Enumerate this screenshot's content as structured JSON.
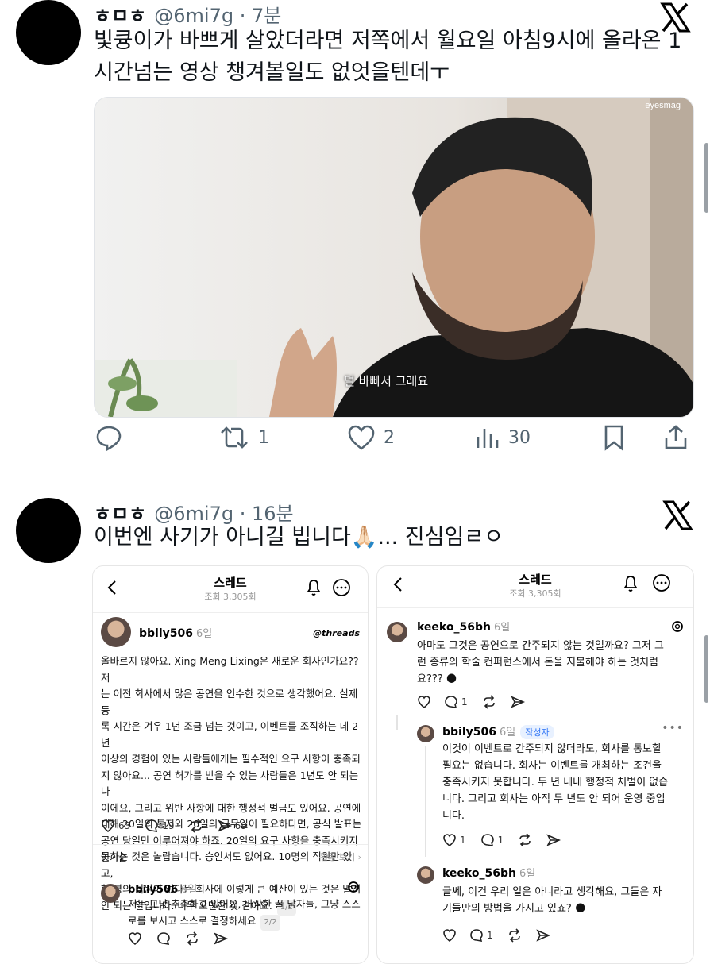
{
  "tweet1": {
    "name": "ㅎㅁㅎ",
    "handle": "@6mi7g",
    "time": "· 7분",
    "text": "빛큥이가 바쁘게 살았더라면 저쪽에서 월요일 아침9시에 올라온 1시간넘는 영상 챙겨볼일도 없엇을텐데ㅜ",
    "media": {
      "watermark": "eyesmag",
      "subtitle": "덜 바빠서 그래요"
    },
    "actions": {
      "retweets": "1",
      "likes": "2",
      "views": "30"
    }
  },
  "tweet2": {
    "name": "ㅎㅁㅎ",
    "handle": "@6mi7g",
    "time": "· 16분",
    "text": "이번엔 사기가 아니길 빕니다🙏🏻... 진심임ㄹㅇ"
  },
  "threads_left": {
    "title": "스레드",
    "views": "조회 3,305회",
    "post": {
      "user": "bbily506",
      "ago": "6일",
      "brand": "threads",
      "lines": [
        "올바르지 않아요. Xing Meng Lixing은 새로운 회사인가요?? 저",
        "는 이전 회사에서 많은 공연을 인수한 것으로 생각했어요. 실제 등",
        "록 시간은 겨우 1년 조금 넘는 것이고, 이벤트를 조직하는 데 2년",
        "이상의 경험이 있는 사람들에게는 필수적인 요구 사항이 충족되",
        "지 않아요... 공연 허가를 받을 수 있는 사람들은 1년도 안 되는 나",
        "이에요, 그리고 위반 사항에 대한 행정적 벌금도 있어요. 공연에",
        "대해 20일의 통지와 20일의 근무일이 필요하다면, 공식 발표는",
        "공연 당일만 이루어져야 하죠. 20일의 요구 사항을 충족시키지",
        "못하는 것은 놀랍습니다. 승인서도 없어요. 10명의 직원만 있고,",
        "한 명의 직원이 없다는 회사에 이렇게 큰 예산이 있는 것은 말이",
        "안 되는 일입니다. 너무 오만한 것 같아요."
      ],
      "page": "1/2",
      "likes": "63",
      "comments": "19",
      "shares": "69"
    },
    "sort_label": "인기순",
    "activity_label": "활동 보기",
    "reply": {
      "user": "bbily506",
      "ago": "6일",
      "lines": [
        "저는 그냥 추측하고 있어요, 바삭한 꿀 남자들, 그냥 스스",
        "로를 보시고 스스로 결정하세요"
      ],
      "page": "2/2"
    }
  },
  "threads_right": {
    "title": "스레드",
    "views": "조회 3,305회",
    "c1": {
      "user": "keeko_56bh",
      "ago": "6일",
      "lines": [
        "아마도 그것은 공연으로 간주되지 않는 것일까요? 그저 그",
        "런 종류의 학술 컨퍼런스에서 돈을 지불해야 하는 것처럼",
        "요??? 🌑"
      ],
      "comments": "1"
    },
    "c2": {
      "user": "bbily506",
      "ago": "6일",
      "author_badge": "작성자",
      "lines": [
        "이것이 이벤트로 간주되지 않더라도, 회사를 통보할",
        "필요는 없습니다. 회사는 이벤트를 개최하는 조건을",
        "충족시키지 못합니다. 두 년 내내 행정적 처벌이 없습",
        "니다. 그리고 회사는 아직 두 년도 안 되어 운영 중입",
        "니다."
      ],
      "likes": "1",
      "comments": "1"
    },
    "c3": {
      "user": "keeko_56bh",
      "ago": "6일",
      "lines": [
        "글쎄, 이건 우리 일은 아니라고 생각해요, 그들은 자",
        "기들만의 방법을 가지고 있죠? 🌑"
      ],
      "comments": "1"
    }
  }
}
